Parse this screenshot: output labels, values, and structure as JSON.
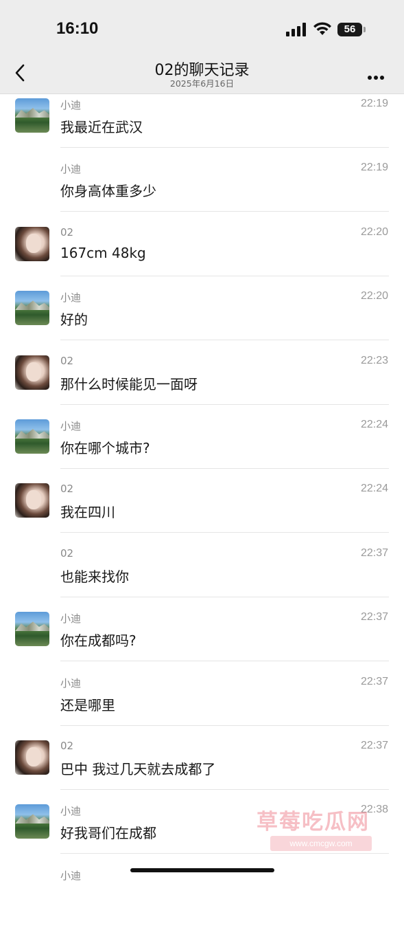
{
  "status_bar": {
    "time": "16:10",
    "battery": "56"
  },
  "nav": {
    "title": "02的聊天记录",
    "subtitle": "2025年6月16日"
  },
  "messages": [
    {
      "sender": "小迪",
      "time": "22:19",
      "text": "我最近在武汉",
      "avatar": "xiaodi"
    },
    {
      "sender": "小迪",
      "time": "22:19",
      "text": "你身高体重多少",
      "avatar": ""
    },
    {
      "sender": "02",
      "time": "22:20",
      "text": "167cm 48kg",
      "avatar": "02"
    },
    {
      "sender": "小迪",
      "time": "22:20",
      "text": "好的",
      "avatar": "xiaodi"
    },
    {
      "sender": "02",
      "time": "22:23",
      "text": "那什么时候能见一面呀",
      "avatar": "02"
    },
    {
      "sender": "小迪",
      "time": "22:24",
      "text": "你在哪个城市?",
      "avatar": "xiaodi"
    },
    {
      "sender": "02",
      "time": "22:24",
      "text": "我在四川",
      "avatar": "02"
    },
    {
      "sender": "02",
      "time": "22:37",
      "text": "也能来找你",
      "avatar": ""
    },
    {
      "sender": "小迪",
      "time": "22:37",
      "text": "你在成都吗?",
      "avatar": "xiaodi"
    },
    {
      "sender": "小迪",
      "time": "22:37",
      "text": "还是哪里",
      "avatar": ""
    },
    {
      "sender": "02",
      "time": "22:37",
      "text": "巴中 我过几天就去成都了",
      "avatar": "02"
    },
    {
      "sender": "小迪",
      "time": "22:38",
      "text": "好我哥们在成都",
      "avatar": "xiaodi"
    },
    {
      "sender": "小迪",
      "time": "",
      "text": "",
      "avatar": ""
    }
  ],
  "watermark": {
    "name": "草莓吃瓜网",
    "url": "www.cmcgw.com"
  }
}
